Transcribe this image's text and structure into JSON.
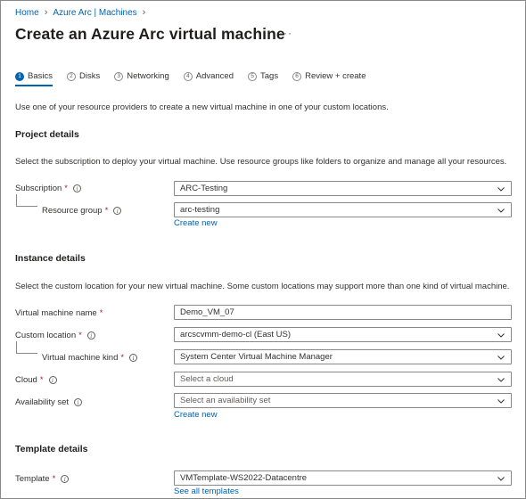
{
  "breadcrumb": {
    "home": "Home",
    "arc_machines": "Azure Arc | Machines",
    "sep": "›"
  },
  "page": {
    "title": "Create an Azure Arc virtual machine",
    "more": "···"
  },
  "tabs": [
    {
      "num": "1",
      "label": "Basics"
    },
    {
      "num": "2",
      "label": "Disks"
    },
    {
      "num": "3",
      "label": "Networking"
    },
    {
      "num": "4",
      "label": "Advanced"
    },
    {
      "num": "5",
      "label": "Tags"
    },
    {
      "num": "6",
      "label": "Review + create"
    }
  ],
  "intro": "Use one of your resource providers to create a new virtual machine in one of your custom locations.",
  "project": {
    "title": "Project details",
    "desc": "Select the subscription to deploy your virtual machine. Use resource groups like folders to organize and manage all your resources.",
    "subscription_label": "Subscription",
    "subscription_value": "ARC-Testing",
    "rg_label": "Resource group",
    "rg_value": "arc-testing",
    "rg_create": "Create new"
  },
  "instance": {
    "title": "Instance details",
    "desc": "Select the custom location for your new virtual machine. Some custom locations may support more than one kind of virtual machine.",
    "vm_name_label": "Virtual machine name",
    "vm_name_value": "Demo_VM_07",
    "location_label": "Custom location",
    "location_value": "arcscvmm-demo-cl (East US)",
    "kind_label": "Virtual machine kind",
    "kind_value": "System Center Virtual Machine Manager",
    "cloud_label": "Cloud",
    "cloud_placeholder": "Select a cloud",
    "avail_label": "Availability set",
    "avail_placeholder": "Select an availability set",
    "avail_create": "Create new"
  },
  "template": {
    "title": "Template details",
    "label": "Template",
    "value": "VMTemplate-WS2022-Datacentre",
    "see_all": "See all templates"
  },
  "marks": {
    "required": "*",
    "info": "i"
  }
}
